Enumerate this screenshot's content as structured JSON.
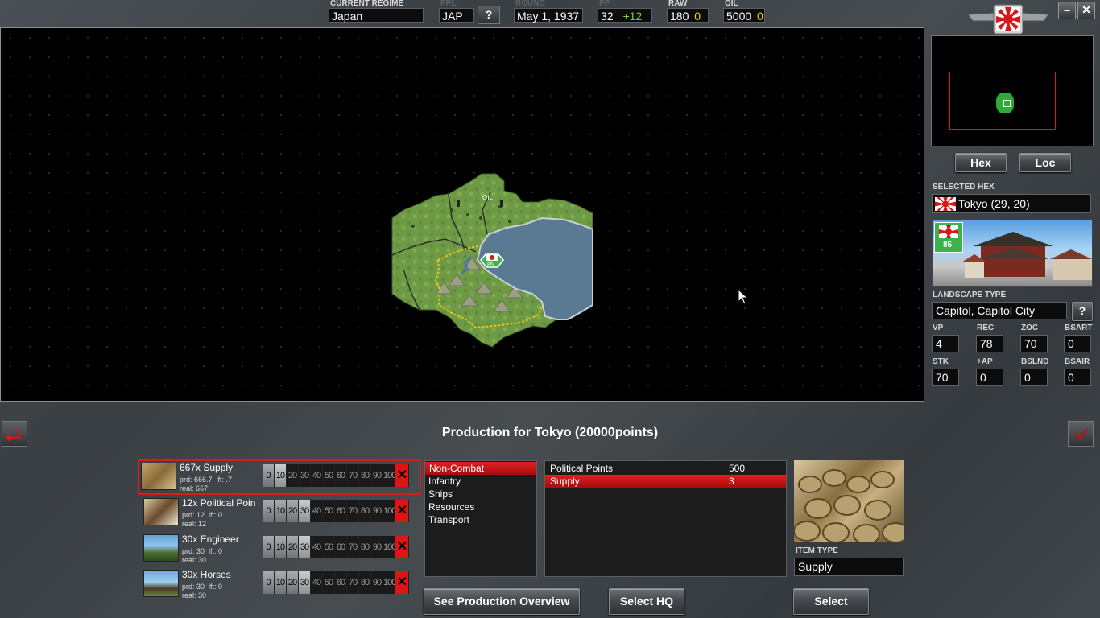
{
  "topbar": {
    "regime_label": "CURRENT REGIME",
    "regime_value": "Japan",
    "ppl_label": "PPL",
    "ppl_value": "JAP",
    "help_label": "?",
    "round_label": "ROUND",
    "round_value": "May 1, 1937",
    "pp_label": "PP",
    "pp_value": "32",
    "pp_delta": "+12",
    "raw_label": "RAW",
    "raw_value": "180",
    "raw_delta": "0",
    "oil_label": "OIL",
    "oil_value": "5000",
    "oil_delta": "0",
    "minimize_label": "–",
    "close_label": "✕"
  },
  "map": {
    "resource_label": "OIL",
    "unit_strength": "85"
  },
  "right_panel": {
    "hex_button": "Hex",
    "loc_button": "Loc",
    "selected_hex_label": "SELECTED HEX",
    "selected_hex_value": "Tokyo (29, 20)",
    "city_badge": "85",
    "landscape_label": "LANDSCAPE TYPE",
    "landscape_value": "Capitol, Capitol City",
    "landscape_help": "?",
    "stats": [
      {
        "label": "VP",
        "value": "4"
      },
      {
        "label": "REC",
        "value": "78"
      },
      {
        "label": "ZOC",
        "value": "70"
      },
      {
        "label": "BSART",
        "value": "0"
      },
      {
        "label": "STK",
        "value": "70"
      },
      {
        "label": "+AP",
        "value": "0"
      },
      {
        "label": "BSLND",
        "value": "0"
      },
      {
        "label": "BSAIR",
        "value": "0"
      }
    ]
  },
  "production": {
    "title": "Production for Tokyo (20000points)",
    "items": [
      {
        "name": "667x Supply",
        "prd": "prd: 666.7",
        "lft": "lft: .7",
        "real": "real: 667",
        "level": 2
      },
      {
        "name": "12x Political Poin",
        "prd": "prd: 12",
        "lft": "lft: 0",
        "real": "real: 12",
        "level": 4
      },
      {
        "name": "30x Engineer",
        "prd": "prd: 30",
        "lft": "lft: 0",
        "real": "real: 30",
        "level": 4
      },
      {
        "name": "30x Horses",
        "prd": "prd: 30",
        "lft": "lft: 0",
        "real": "real: 30",
        "level": 4
      }
    ],
    "slider_ticks": [
      "0",
      "10",
      "20",
      "30",
      "40",
      "50",
      "60",
      "70",
      "80",
      "90",
      "100"
    ],
    "slider_x": "✕",
    "categories": [
      "Non-Combat",
      "Infantry",
      "Ships",
      "Resources",
      "Transport"
    ],
    "selected_category": "Non-Combat",
    "types": [
      {
        "name": "Political Points",
        "cost": "500"
      },
      {
        "name": "Supply",
        "cost": "3"
      }
    ],
    "item_type_label": "ITEM TYPE",
    "item_type_value": "Supply",
    "overview_button": "See Production Overview",
    "select_hq_button": "Select HQ",
    "select_button": "Select"
  },
  "colors": {
    "accent_red": "#e01414",
    "positive_green": "#7ccf3c",
    "highlight_yellow": "#f0d000"
  }
}
